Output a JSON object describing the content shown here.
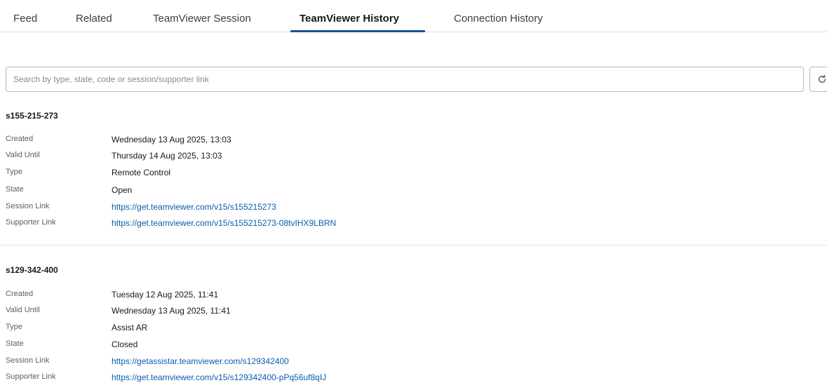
{
  "tabs": [
    {
      "label": "Feed"
    },
    {
      "label": "Related"
    },
    {
      "label": "TeamViewer Session"
    },
    {
      "label": "TeamViewer History",
      "active": true
    },
    {
      "label": "Connection History"
    }
  ],
  "search": {
    "placeholder": "Search by type, state, code or session/supporter link",
    "value": ""
  },
  "icons": {
    "refresh": "refresh-icon"
  },
  "labels": {
    "created": "Created",
    "valid_until": "Valid Until",
    "type": "Type",
    "state": "State",
    "session_link": "Session Link",
    "supporter_link": "Supporter Link"
  },
  "sessions": [
    {
      "code": "s155-215-273",
      "created": "Wednesday 13 Aug 2025, 13:03",
      "valid_until": "Thursday 14 Aug 2025, 13:03",
      "type": "Remote Control",
      "state": "Open",
      "session_link": "https://get.teamviewer.com/v15/s155215273",
      "supporter_link": "https://get.teamviewer.com/v15/s155215273-08tvIHX9LBRN"
    },
    {
      "code": "s129-342-400",
      "created": "Tuesday 12 Aug 2025, 11:41",
      "valid_until": "Wednesday 13 Aug 2025, 11:41",
      "type": "Assist AR",
      "state": "Closed",
      "session_link": "https://getassistar.teamviewer.com/s129342400",
      "supporter_link": "https://get.teamviewer.com/v15/s129342400-pPq56uf8qIJ"
    }
  ],
  "colors": {
    "link": "#0b5cab",
    "active_tab_underline": "#1b5297"
  }
}
